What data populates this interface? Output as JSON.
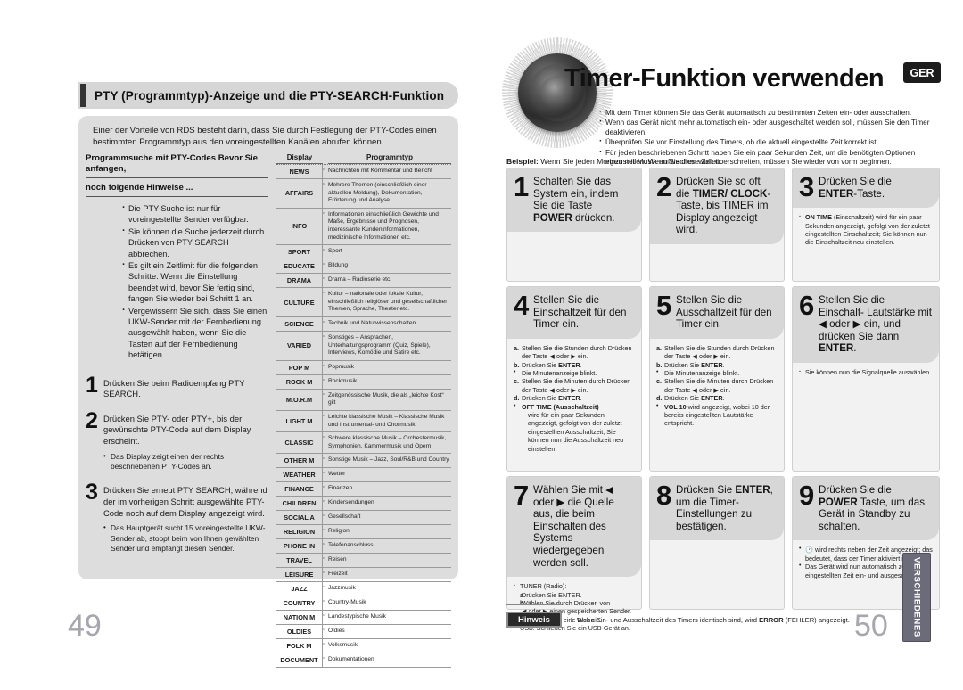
{
  "left_page": {
    "page_number": "49",
    "section_title": "PTY (Programmtyp)-Anzeige und die PTY-SEARCH-Funktion",
    "intro": "Einer der Vorteile von RDS besteht darin, dass Sie durch Festlegung der PTY-Codes einen bestimmten Programmtyp aus den voreingestellten Kanälen abrufen können.",
    "subhead_1": "Programmsuche mit PTY-Codes Bevor Sie anfangen,",
    "subhead_2": "noch folgende Hinweise ...",
    "notes": [
      "Die PTY-Suche ist nur für voreingestellte Sender verfügbar.",
      "Sie können die Suche jederzeit durch Drücken von PTY SEARCH abbrechen.",
      "Es gilt ein Zeitlimit für die folgenden Schritte. Wenn die Einstellung beendet wird, bevor Sie fertig sind, fangen Sie wieder bei Schritt 1 an.",
      "Vergewissern Sie sich, dass Sie einen UKW-Sender mit der Fernbedienung ausgewählt haben, wenn Sie die Tasten auf der Fernbedienung betätigen."
    ],
    "steps": [
      {
        "num": "1",
        "text": "Drücken Sie beim Radioempfang PTY SEARCH.",
        "sub": ""
      },
      {
        "num": "2",
        "text": "Drücken Sie PTY- oder PTY+, bis der gewünschte PTY-Code auf dem Display erscheint.",
        "sub": "Das Display zeigt einen der rechts beschriebenen PTY-Codes an."
      },
      {
        "num": "3",
        "text": "Drücken Sie erneut PTY SEARCH, während der im vorherigen Schritt ausgewählte PTY-Code noch auf dem Display angezeigt wird.",
        "sub": "Das Hauptgerät sucht 15 voreingestellte UKW-Sender ab, stoppt beim von Ihnen gewählten Sender und empfängt diesen Sender."
      }
    ],
    "pty_table": {
      "col_display": "Display",
      "col_type": "Programmtyp",
      "rows": [
        {
          "display": "NEWS",
          "desc": "Nachrichten mit Kommentar und Bericht"
        },
        {
          "display": "AFFAIRS",
          "desc": "Mehrere Themen (einschließlich einer aktuellen Meldung), Dokumentation, Erörterung und Analyse."
        },
        {
          "display": "INFO",
          "desc": "Informationen einschließlich Gewichte und Maße, Ergebnisse und Prognosen, interessante Kundeninformationen, medizinische Informationen etc."
        },
        {
          "display": "SPORT",
          "desc": "Sport"
        },
        {
          "display": "EDUCATE",
          "desc": "Bildung"
        },
        {
          "display": "DRAMA",
          "desc": "Drama – Radioserie etc."
        },
        {
          "display": "CULTURE",
          "desc": "Kultur – nationale oder lokale Kultur, einschließlich religiöser und gesellschaftlicher Themen, Sprache, Theater etc."
        },
        {
          "display": "SCIENCE",
          "desc": "Technik und Naturwissenschaften"
        },
        {
          "display": "VARIED",
          "desc": "Sonstiges – Ansprachen, Unterhaltungsprogramm (Quiz, Spiele), Interviews, Komödie und Satire etc."
        },
        {
          "display": "POP M",
          "desc": "Popmusik"
        },
        {
          "display": "ROCK M",
          "desc": "Rockmusik"
        },
        {
          "display": "M.O.R.M",
          "desc": "Zeitgenössische Musik, die als „leichte Kost“ gilt"
        },
        {
          "display": "LIGHT M",
          "desc": "Leichte klassische Musik – Klassische Musik und Instrumental- und Chormusik"
        },
        {
          "display": "CLASSIC",
          "desc": "Schwere klassische Musik – Orchestermusik, Symphonien, Kammermusik und Opern"
        },
        {
          "display": "OTHER M",
          "desc": "Sonstige Musik – Jazz, Soul/R&B und Country"
        },
        {
          "display": "WEATHER",
          "desc": "Wetter"
        },
        {
          "display": "FINANCE",
          "desc": "Finanzen"
        },
        {
          "display": "CHILDREN",
          "desc": "Kindersendungen"
        },
        {
          "display": "SOCIAL A",
          "desc": "Gesellschaft"
        },
        {
          "display": "RELIGION",
          "desc": "Religion"
        },
        {
          "display": "PHONE IN",
          "desc": "Telefonanschluss"
        },
        {
          "display": "TRAVEL",
          "desc": "Reisen"
        },
        {
          "display": "LEISURE",
          "desc": "Freizeit"
        },
        {
          "display": "JAZZ",
          "desc": "Jazzmusik"
        },
        {
          "display": "COUNTRY",
          "desc": "Country-Musik"
        },
        {
          "display": "NATION M",
          "desc": "Landestypische Musik"
        },
        {
          "display": "OLDIES",
          "desc": "Oldies"
        },
        {
          "display": "FOLK M",
          "desc": "Volksmusik"
        },
        {
          "display": "DOCUMENT",
          "desc": "Dokumentationen"
        }
      ]
    }
  },
  "right_page": {
    "page_number": "50",
    "title": "Timer-Funktion verwenden",
    "lang_badge": "GER",
    "intro_bullets": [
      "Mit dem Timer können Sie das Gerät automatisch zu bestimmten Zeiten ein- oder ausschalten.",
      "Wenn das Gerät nicht mehr automatisch ein- oder ausgeschaltet werden soll, müssen Sie den Timer deaktivieren.",
      "Überprüfen Sie vor Einstellung des Timers, ob die aktuell eingestellte Zeit korrekt ist.",
      "Für jeden beschriebenen Schritt haben Sie ein paar Sekunden Zeit, um die benötigten Optionen einzustellen. Wenn Sie diese Zeit überschreiten, müssen Sie wieder von vorm beginnen."
    ],
    "beispiel_label": "Beispiel:",
    "beispiel_text": "Wenn Sie jeden Morgen mit Musik aufwachen wollen.",
    "steps": [
      {
        "num": "1",
        "title_parts": [
          {
            "t": "Schalten Sie das System ein, indem Sie die Taste ",
            "b": false
          },
          {
            "t": "POWER",
            "b": true
          },
          {
            "t": " drücken.",
            "b": false
          }
        ],
        "body": []
      },
      {
        "num": "2",
        "title_parts": [
          {
            "t": "Drücken Sie so oft die ",
            "b": false
          },
          {
            "t": "TIMER/ CLOCK",
            "b": true
          },
          {
            "t": "-Taste, bis TIMER im Display angezeigt wird.",
            "b": false
          }
        ],
        "body": []
      },
      {
        "num": "3",
        "title_parts": [
          {
            "t": "Drücken Sie die ",
            "b": false
          },
          {
            "t": "ENTER",
            "b": true
          },
          {
            "t": "-Taste.",
            "b": false
          }
        ],
        "body": [
          {
            "kind": "dot",
            "parts": [
              {
                "t": "ON TIME",
                "b": true
              },
              {
                "t": " (Einschaltzeit) wird für ein paar Sekunden angezeigt, gefolgt von der zuletzt eingestellten Einschaltzeit; Sie können nun die Einschaltzeit neu einstellen.",
                "b": false
              }
            ]
          }
        ]
      },
      {
        "num": "4",
        "title_parts": [
          {
            "t": "Stellen Sie die Einschaltzeit für den Timer ein.",
            "b": false
          }
        ],
        "body": [
          {
            "kind": "letter",
            "letter": "a.",
            "parts": [
              {
                "t": "Stellen Sie die Stunden durch Drücken der Taste ◀ oder ▶ ein.",
                "b": false
              }
            ]
          },
          {
            "kind": "letter",
            "letter": "b.",
            "parts": [
              {
                "t": "Drücken Sie ",
                "b": false
              },
              {
                "t": "ENTER",
                "b": true
              },
              {
                "t": ".",
                "b": false
              }
            ]
          },
          {
            "kind": "bul-ind",
            "parts": [
              {
                "t": "Die Minutenanzeige blinkt.",
                "b": false
              }
            ]
          },
          {
            "kind": "letter",
            "letter": "c.",
            "parts": [
              {
                "t": "Stellen Sie die Minuten durch Drücken der Taste ◀ oder ▶ ein.",
                "b": false
              }
            ]
          },
          {
            "kind": "letter",
            "letter": "d.",
            "parts": [
              {
                "t": "Drücken Sie ",
                "b": false
              },
              {
                "t": "ENTER",
                "b": true
              },
              {
                "t": ".",
                "b": false
              }
            ]
          },
          {
            "kind": "bul-ind",
            "parts": [
              {
                "t": "OFF TIME (Ausschaltzeit)",
                "b": true
              }
            ]
          },
          {
            "kind": "plain-ind2",
            "parts": [
              {
                "t": "wird für ein paar Sekunden angezeigt, gefolgt von der zuletzt eingestellten Ausschaltzeit; Sie können nun die Ausschaltzeit neu einstellen.",
                "b": false
              }
            ]
          }
        ]
      },
      {
        "num": "5",
        "title_parts": [
          {
            "t": "Stellen Sie die Ausschaltzeit für den Timer ein.",
            "b": false
          }
        ],
        "body": [
          {
            "kind": "letter",
            "letter": "a.",
            "parts": [
              {
                "t": "Stellen Sie die Stunden durch Drücken der Taste ◀ oder ▶ ein.",
                "b": false
              }
            ]
          },
          {
            "kind": "letter",
            "letter": "b.",
            "parts": [
              {
                "t": "Drücken Sie ",
                "b": false
              },
              {
                "t": "ENTER",
                "b": true
              },
              {
                "t": ".",
                "b": false
              }
            ]
          },
          {
            "kind": "bul-ind",
            "parts": [
              {
                "t": "Die Minutenanzeige blinkt.",
                "b": false
              }
            ]
          },
          {
            "kind": "letter",
            "letter": "c.",
            "parts": [
              {
                "t": "Stellen Sie die Minuten durch Drücken der Taste ◀ oder ▶ ein.",
                "b": false
              }
            ]
          },
          {
            "kind": "letter",
            "letter": "d.",
            "parts": [
              {
                "t": "Drücken Sie ",
                "b": false
              },
              {
                "t": "ENTER",
                "b": true
              },
              {
                "t": ".",
                "b": false
              }
            ]
          },
          {
            "kind": "bul-ind",
            "parts": [
              {
                "t": "VOL 10",
                "b": true
              },
              {
                "t": " wird angezeigt, wobei 10 der bereits eingestellten Lautstärke entspricht.",
                "b": false
              }
            ]
          }
        ]
      },
      {
        "num": "6",
        "title_parts": [
          {
            "t": "Stellen Sie die Einschalt- Lautstärke mit ◀ oder ▶ ein, und drücken Sie dann ",
            "b": false
          },
          {
            "t": "ENTER",
            "b": true
          },
          {
            "t": ".",
            "b": false
          }
        ],
        "body": [
          {
            "kind": "dot",
            "parts": [
              {
                "t": "Sie können nun die Signalquelle auswählen.",
                "b": false
              }
            ]
          }
        ]
      },
      {
        "num": "7",
        "title_parts": [
          {
            "t": "Wählen Sie mit ◀ oder ▶ die Quelle aus, die beim Einschalten des Systems wiedergegeben werden soll.",
            "b": false
          }
        ],
        "body": [
          {
            "kind": "dot",
            "parts": [
              {
                "t": "TUNER (Radio):",
                "b": false
              }
            ]
          },
          {
            "kind": "letter-s",
            "letter": "a",
            "parts": [
              {
                "t": "Drücken Sie ENTER.",
                "b": false
              }
            ]
          },
          {
            "kind": "letter-s",
            "letter": "b",
            "parts": [
              {
                "t": "Wählen Sie durch Drücken von",
                "b": false
              }
            ]
          },
          {
            "kind": "plain-ind",
            "parts": [
              {
                "t": "◀ oder ▶ einen gespeicherten Sender.",
                "b": false
              }
            ]
          },
          {
            "kind": "dot",
            "parts": [
              {
                "t": "CD: Legen Sie eine Disk ein.",
                "b": false
              }
            ]
          },
          {
            "kind": "dot",
            "parts": [
              {
                "t": "USB: Schließen Sie ein USB-Gerät an.",
                "b": false
              }
            ]
          }
        ]
      },
      {
        "num": "8",
        "title_parts": [
          {
            "t": "Drücken Sie ",
            "b": false
          },
          {
            "t": "ENTER",
            "b": true
          },
          {
            "t": ", um die Timer-Einstellungen zu bestätigen.",
            "b": false
          }
        ],
        "body": []
      },
      {
        "num": "9",
        "title_parts": [
          {
            "t": "Drücken Sie die ",
            "b": false
          },
          {
            "t": "POWER",
            "b": true
          },
          {
            "t": " Taste, um das Gerät in Standby zu schalten.",
            "b": false
          }
        ],
        "body": [
          {
            "kind": "bul",
            "parts": [
              {
                "t": "🕐 wird rechts neben der Zeit angezeigt; das bedeutet, dass der Timer aktiviert ist.",
                "b": false
              }
            ]
          },
          {
            "kind": "bul",
            "parts": [
              {
                "t": "Das Gerät wird nun automatisch zur eingestellten Zeit ein- und ausgeschaltet.",
                "b": false
              }
            ]
          }
        ]
      }
    ],
    "hinweis_badge": "Hinweis",
    "hinweis_parts": [
      {
        "t": "Wenn Ein- und Ausschaltzeit des Timers identisch sind, wird ",
        "b": false
      },
      {
        "t": "ERROR",
        "b": true
      },
      {
        "t": " (FEHLER) angezeigt.",
        "b": false
      }
    ],
    "side_tab": "VERSCHIEDENES"
  }
}
